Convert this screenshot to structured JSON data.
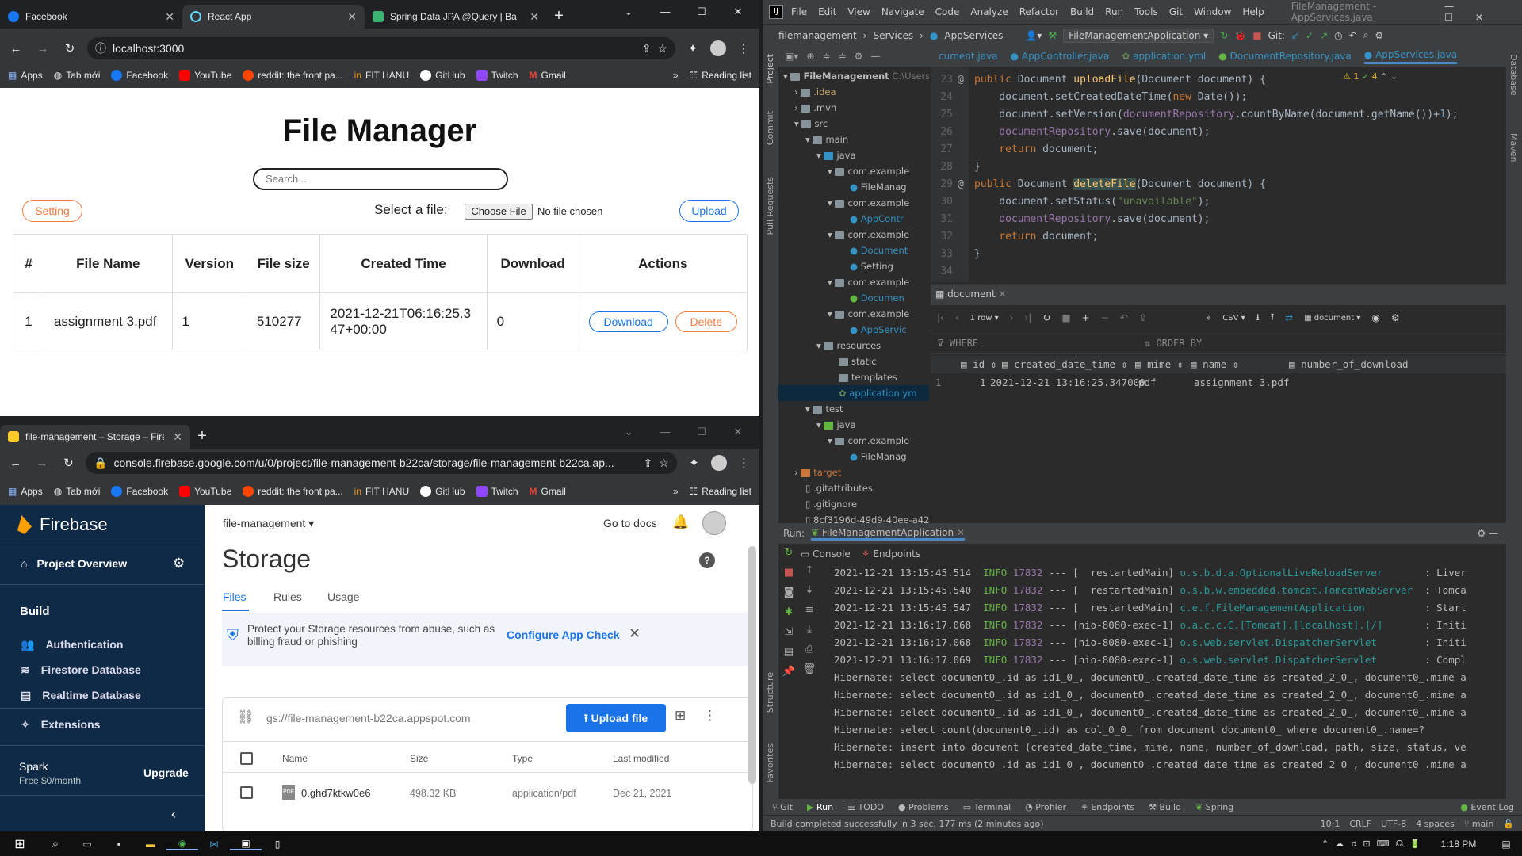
{
  "chrome1": {
    "tabs": [
      {
        "title": "Facebook"
      },
      {
        "title": "React App"
      },
      {
        "title": "Spring Data JPA @Query | Bae"
      }
    ],
    "url": "localhost:3000"
  },
  "chrome2": {
    "tabs": [
      {
        "title": "file-management – Storage – Fire"
      }
    ],
    "url": "console.firebase.google.com/u/0/project/file-management-b22ca/storage/file-management-b22ca.ap..."
  },
  "bookmarks": [
    "Apps",
    "Tab mới",
    "Facebook",
    "YouTube",
    "reddit: the front pa...",
    "FIT HANU",
    "GitHub",
    "Twitch",
    "Gmail"
  ],
  "reading_list": "Reading list",
  "react": {
    "title": "File Manager",
    "search_placeholder": "Search...",
    "setting_label": "Setting",
    "select_label": "Select a file:",
    "choose_file_label": "Choose File",
    "no_file_label": "No file chosen",
    "upload_label": "Upload",
    "columns": [
      "#",
      "File Name",
      "Version",
      "File size",
      "Created Time",
      "Download",
      "Actions"
    ],
    "rows": [
      {
        "num": "1",
        "name": "assignment 3.pdf",
        "version": "1",
        "size": "510277",
        "created": "2021-12-21T06:16:25.347+00:00",
        "download": "0",
        "download_btn": "Download",
        "delete_btn": "Delete"
      }
    ]
  },
  "firebase": {
    "brand": "Firebase",
    "project_overview": "Project Overview",
    "build_heading": "Build",
    "nav": [
      "Authentication",
      "Firestore Database",
      "Realtime Database",
      "Extensions"
    ],
    "plan_name": "Spark",
    "plan_desc": "Free $0/month",
    "upgrade": "Upgrade",
    "project_name": "file-management",
    "go_to_docs": "Go to docs",
    "page_title": "Storage",
    "tabs": [
      "Files",
      "Rules",
      "Usage"
    ],
    "banner_text": "Protect your Storage resources from abuse, such as billing fraud or phishing",
    "banner_link": "Configure App Check",
    "bucket": "gs://file-management-b22ca.appspot.com",
    "upload_file": "Upload file",
    "columns": [
      "Name",
      "Size",
      "Type",
      "Last modified"
    ],
    "files": [
      {
        "name": "0.ghd7ktkw0e6",
        "size": "498.32 KB",
        "type": "application/pdf",
        "modified": "Dec 21, 2021"
      }
    ]
  },
  "ide": {
    "menu": [
      "File",
      "Edit",
      "View",
      "Navigate",
      "Code",
      "Analyze",
      "Refactor",
      "Build",
      "Run",
      "Tools",
      "Git",
      "Window",
      "Help"
    ],
    "window_title": "FileManagement - AppServices.java",
    "breadcrumb": [
      "filemanagement",
      "Services",
      "AppServices"
    ],
    "run_config": "FileManagementApplication",
    "git_label": "Git:",
    "editor_tabs": [
      "cument.java",
      "AppController.java",
      "application.yml",
      "DocumentRepository.java",
      "AppServices.java"
    ],
    "project_root": "FileManagement",
    "project_root_path": "C:\\Users",
    "tree": [
      ".idea",
      ".mvn",
      "src",
      "main",
      "java",
      "com.example",
      "FileManag",
      "com.example",
      "AppContr",
      "com.example",
      "Document",
      "Setting",
      "com.example",
      "Documen",
      "com.example",
      "AppServic",
      "resources",
      "static",
      "templates",
      "application.ym",
      "test",
      "java",
      "com.example",
      "FileManag",
      "target",
      ".gitattributes",
      ".gitignore",
      "8cf3196d-49d9-40ee-a42"
    ],
    "line_numbers": [
      "23",
      "24",
      "25",
      "26",
      "27",
      "28",
      "29",
      "30",
      "31",
      "32",
      "33",
      "34"
    ],
    "inspection_warnings": "1",
    "inspection_ok": "4",
    "db_tab": "document",
    "db_rows_label": "1 row",
    "db_export": "CSV",
    "db_table_name": "document",
    "db_where": "WHERE",
    "db_order": "ORDER BY",
    "db_columns": [
      "id",
      "created_date_time",
      "mime",
      "name",
      "number_of_download"
    ],
    "db_row": {
      "rownum": "1",
      "id": "1",
      "created_date_time": "2021-12-21 13:16:25.347000",
      "mime": "pdf",
      "name": "assignment 3.pdf"
    },
    "run_label": "Run:",
    "run_tab": "FileManagementApplication",
    "run_subtabs": [
      "Console",
      "Endpoints"
    ],
    "side_tools_left": [
      "Project",
      "Commit",
      "Pull Requests",
      "Structure",
      "Favorites"
    ],
    "side_tools_right": [
      "Database",
      "Maven"
    ],
    "bottom_tools": [
      "Git",
      "Run",
      "TODO",
      "Problems",
      "Terminal",
      "Profiler",
      "Endpoints",
      "Build",
      "Spring"
    ],
    "event_log": "Event Log",
    "status_msg": "Build completed successfully in 3 sec, 177 ms (2 minutes ago)",
    "status_right": [
      "10:1",
      "CRLF",
      "UTF-8",
      "4 spaces",
      "main"
    ]
  },
  "taskbar": {
    "time": "1:18 PM"
  }
}
